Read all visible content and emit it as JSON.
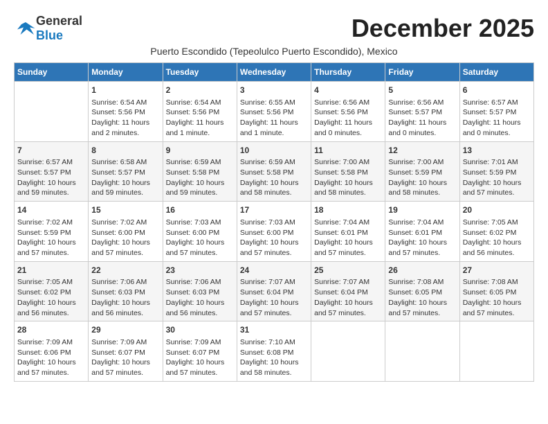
{
  "header": {
    "logo_general": "General",
    "logo_blue": "Blue",
    "month_title": "December 2025",
    "subtitle": "Puerto Escondido (Tepeolulco Puerto Escondido), Mexico"
  },
  "days_of_week": [
    "Sunday",
    "Monday",
    "Tuesday",
    "Wednesday",
    "Thursday",
    "Friday",
    "Saturday"
  ],
  "weeks": [
    [
      {
        "day": "",
        "info": ""
      },
      {
        "day": "1",
        "info": "Sunrise: 6:54 AM\nSunset: 5:56 PM\nDaylight: 11 hours\nand 2 minutes."
      },
      {
        "day": "2",
        "info": "Sunrise: 6:54 AM\nSunset: 5:56 PM\nDaylight: 11 hours\nand 1 minute."
      },
      {
        "day": "3",
        "info": "Sunrise: 6:55 AM\nSunset: 5:56 PM\nDaylight: 11 hours\nand 1 minute."
      },
      {
        "day": "4",
        "info": "Sunrise: 6:56 AM\nSunset: 5:56 PM\nDaylight: 11 hours\nand 0 minutes."
      },
      {
        "day": "5",
        "info": "Sunrise: 6:56 AM\nSunset: 5:57 PM\nDaylight: 11 hours\nand 0 minutes."
      },
      {
        "day": "6",
        "info": "Sunrise: 6:57 AM\nSunset: 5:57 PM\nDaylight: 11 hours\nand 0 minutes."
      }
    ],
    [
      {
        "day": "7",
        "info": "Sunrise: 6:57 AM\nSunset: 5:57 PM\nDaylight: 10 hours\nand 59 minutes."
      },
      {
        "day": "8",
        "info": "Sunrise: 6:58 AM\nSunset: 5:57 PM\nDaylight: 10 hours\nand 59 minutes."
      },
      {
        "day": "9",
        "info": "Sunrise: 6:59 AM\nSunset: 5:58 PM\nDaylight: 10 hours\nand 59 minutes."
      },
      {
        "day": "10",
        "info": "Sunrise: 6:59 AM\nSunset: 5:58 PM\nDaylight: 10 hours\nand 58 minutes."
      },
      {
        "day": "11",
        "info": "Sunrise: 7:00 AM\nSunset: 5:58 PM\nDaylight: 10 hours\nand 58 minutes."
      },
      {
        "day": "12",
        "info": "Sunrise: 7:00 AM\nSunset: 5:59 PM\nDaylight: 10 hours\nand 58 minutes."
      },
      {
        "day": "13",
        "info": "Sunrise: 7:01 AM\nSunset: 5:59 PM\nDaylight: 10 hours\nand 57 minutes."
      }
    ],
    [
      {
        "day": "14",
        "info": "Sunrise: 7:02 AM\nSunset: 5:59 PM\nDaylight: 10 hours\nand 57 minutes."
      },
      {
        "day": "15",
        "info": "Sunrise: 7:02 AM\nSunset: 6:00 PM\nDaylight: 10 hours\nand 57 minutes."
      },
      {
        "day": "16",
        "info": "Sunrise: 7:03 AM\nSunset: 6:00 PM\nDaylight: 10 hours\nand 57 minutes."
      },
      {
        "day": "17",
        "info": "Sunrise: 7:03 AM\nSunset: 6:00 PM\nDaylight: 10 hours\nand 57 minutes."
      },
      {
        "day": "18",
        "info": "Sunrise: 7:04 AM\nSunset: 6:01 PM\nDaylight: 10 hours\nand 57 minutes."
      },
      {
        "day": "19",
        "info": "Sunrise: 7:04 AM\nSunset: 6:01 PM\nDaylight: 10 hours\nand 57 minutes."
      },
      {
        "day": "20",
        "info": "Sunrise: 7:05 AM\nSunset: 6:02 PM\nDaylight: 10 hours\nand 56 minutes."
      }
    ],
    [
      {
        "day": "21",
        "info": "Sunrise: 7:05 AM\nSunset: 6:02 PM\nDaylight: 10 hours\nand 56 minutes."
      },
      {
        "day": "22",
        "info": "Sunrise: 7:06 AM\nSunset: 6:03 PM\nDaylight: 10 hours\nand 56 minutes."
      },
      {
        "day": "23",
        "info": "Sunrise: 7:06 AM\nSunset: 6:03 PM\nDaylight: 10 hours\nand 56 minutes."
      },
      {
        "day": "24",
        "info": "Sunrise: 7:07 AM\nSunset: 6:04 PM\nDaylight: 10 hours\nand 57 minutes."
      },
      {
        "day": "25",
        "info": "Sunrise: 7:07 AM\nSunset: 6:04 PM\nDaylight: 10 hours\nand 57 minutes."
      },
      {
        "day": "26",
        "info": "Sunrise: 7:08 AM\nSunset: 6:05 PM\nDaylight: 10 hours\nand 57 minutes."
      },
      {
        "day": "27",
        "info": "Sunrise: 7:08 AM\nSunset: 6:05 PM\nDaylight: 10 hours\nand 57 minutes."
      }
    ],
    [
      {
        "day": "28",
        "info": "Sunrise: 7:09 AM\nSunset: 6:06 PM\nDaylight: 10 hours\nand 57 minutes."
      },
      {
        "day": "29",
        "info": "Sunrise: 7:09 AM\nSunset: 6:07 PM\nDaylight: 10 hours\nand 57 minutes."
      },
      {
        "day": "30",
        "info": "Sunrise: 7:09 AM\nSunset: 6:07 PM\nDaylight: 10 hours\nand 57 minutes."
      },
      {
        "day": "31",
        "info": "Sunrise: 7:10 AM\nSunset: 6:08 PM\nDaylight: 10 hours\nand 58 minutes."
      },
      {
        "day": "",
        "info": ""
      },
      {
        "day": "",
        "info": ""
      },
      {
        "day": "",
        "info": ""
      }
    ]
  ]
}
